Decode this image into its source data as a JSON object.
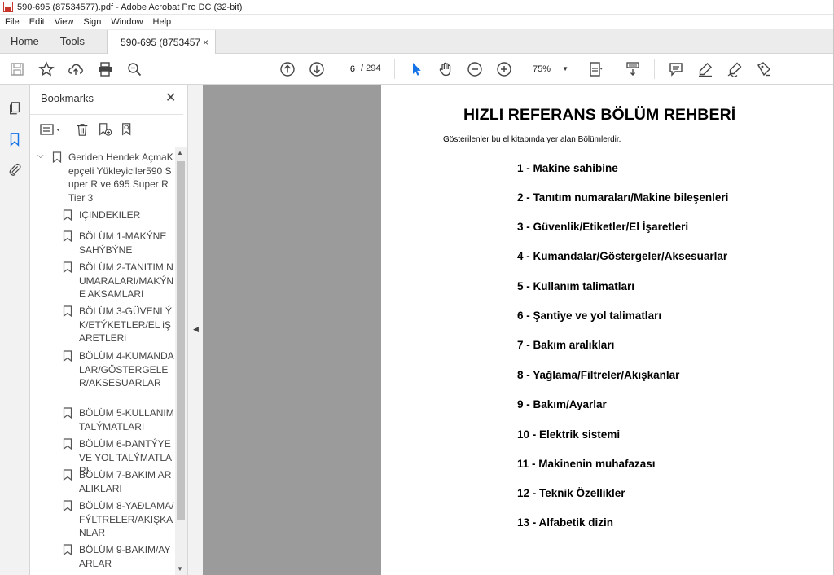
{
  "window": {
    "title": "590-695 (87534577).pdf - Adobe Acrobat Pro DC (32-bit)"
  },
  "menu": [
    "File",
    "Edit",
    "View",
    "Sign",
    "Window",
    "Help"
  ],
  "tabs": {
    "home": "Home",
    "tools": "Tools",
    "document": "590-695 (8753457...",
    "close": "×"
  },
  "toolbar": {
    "page_current": "6",
    "page_total": "/ 294",
    "zoom": "75%",
    "zoom_caret": "▼"
  },
  "bookmarks": {
    "title": "Bookmarks",
    "close": "✕",
    "items": [
      {
        "label": "Geriden Hendek AçmaKepçeli Yükleyiciler590 Super R ve 695 Super R Tier 3"
      },
      {
        "label": "IÇINDEKILER"
      },
      {
        "label": "BÖLÜM 1-MAKÝNE SAHÝBÝNE"
      },
      {
        "label": "BÖLÜM 2-TANITIM NUMARALARI/MAKÝNE AKSAMLARI"
      },
      {
        "label": "BÖLÜM 3-GÜVENLÝK/ETÝKETLER/EL iŞARETLERi"
      },
      {
        "label": "BÖLÜM 4-KUMANDALAR/GÖSTERGELER/AKSESUARLAR"
      },
      {
        "label": "BÖLÜM 5-KULLANIM TALÝMATLARI"
      },
      {
        "label": "BÖLÜM 6-ÞANTÝYE VE YOL TALÝMATLARI"
      },
      {
        "label": "BÖLÜM 7-BAKIM ARALIKLARI"
      },
      {
        "label": "BÖLÜM 8-YAÐLAMA/FÝLTRELER/AKIŞKANLAR"
      },
      {
        "label": "BÖLÜM 9-BAKIM/AYARLAR"
      }
    ]
  },
  "document": {
    "title": "HIZLI REFERANS BÖLÜM REHBERİ",
    "subtitle": "Gösterilenler bu el kitabında yer alan Bölümlerdir.",
    "sections": [
      "1 - Makine sahibine",
      "2 - Tanıtım numaraları/Makine bileşenleri",
      "3 - Güvenlik/Etiketler/El İşaretleri",
      "4 - Kumandalar/Göstergeler/Aksesuarlar",
      "5 - Kullanım talimatları",
      "6 - Şantiye ve yol talimatları",
      "7 - Bakım aralıkları",
      "8 - Yağlama/Filtreler/Akışkanlar",
      "9 - Bakım/Ayarlar",
      "10 - Elektrik sistemi",
      "11 - Makinenin muhafazası",
      "12 - Teknik Özellikler",
      "13 - Alfabetik dizin"
    ]
  },
  "colors": {
    "accent": "#1473e6",
    "viewer_bg": "#9b9b9b",
    "pdf_red": "#c8352b"
  }
}
